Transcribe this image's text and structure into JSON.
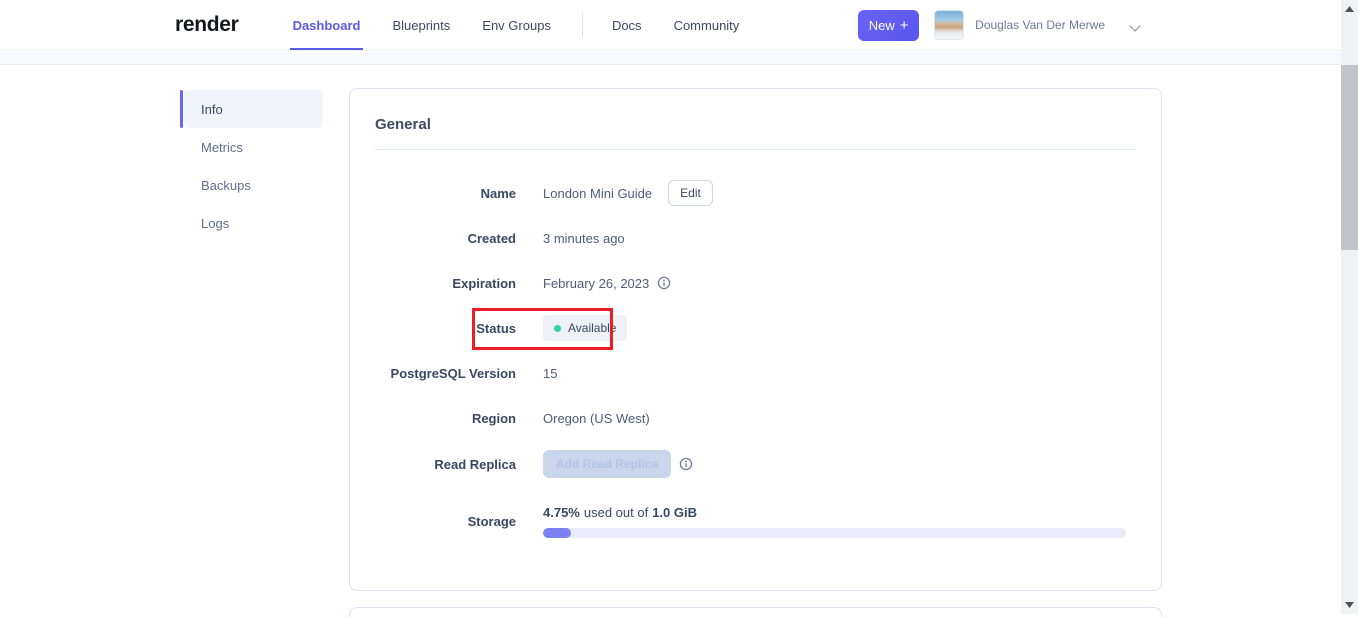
{
  "colors": {
    "accent": "#5a5bea",
    "status_dot": "#2ed3a5",
    "annotation_red": "#ee1c25",
    "progress_fill": "#7b80f2"
  },
  "header": {
    "logo": "render",
    "nav_items": [
      {
        "label": "Dashboard",
        "active": true
      },
      {
        "label": "Blueprints",
        "active": false
      },
      {
        "label": "Env Groups",
        "active": false
      },
      {
        "label": "Docs",
        "active": false
      },
      {
        "label": "Community",
        "active": false
      }
    ],
    "new_button": {
      "label": "New",
      "icon": "+"
    },
    "user_name": "Douglas Van Der Merwe"
  },
  "sidebar": {
    "items": [
      {
        "label": "Info",
        "active": true
      },
      {
        "label": "Metrics",
        "active": false
      },
      {
        "label": "Backups",
        "active": false
      },
      {
        "label": "Logs",
        "active": false
      }
    ]
  },
  "general": {
    "title": "General",
    "name_row": {
      "label": "Name",
      "value": "London Mini Guide",
      "edit_button": "Edit"
    },
    "created_row": {
      "label": "Created",
      "value": "3 minutes ago"
    },
    "expiration_row": {
      "label": "Expiration",
      "value": "February 26, 2023"
    },
    "status_row": {
      "label": "Status",
      "badge": "Available"
    },
    "version_row": {
      "label": "PostgreSQL Version",
      "value": "15"
    },
    "region_row": {
      "label": "Region",
      "value": "Oregon (US West)"
    },
    "read_replica_row": {
      "label": "Read Replica",
      "button": "Add Read Replica"
    },
    "storage_row": {
      "label": "Storage",
      "used_pct": "4.75%",
      "connector": "used out of",
      "total": "1.0 GiB",
      "progress_percent": 4.75
    }
  }
}
